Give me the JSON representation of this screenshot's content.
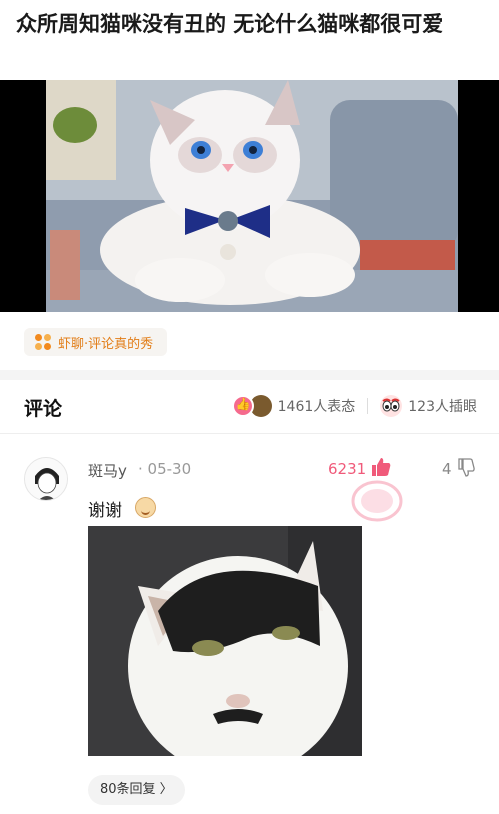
{
  "post": {
    "title": "众所周知猫咪没有丑的 无论什么猫咪都很可爱"
  },
  "topic_tag": {
    "label": "虾聊·评论真的秀",
    "color": "#e27d17"
  },
  "comments_header": {
    "title": "评论",
    "reactions_count": "1461人表态",
    "shares_count": "123人插眼"
  },
  "comment": {
    "username": "斑马y",
    "date": "· 05-30",
    "likes": "6231",
    "replies": "4",
    "text": "谢谢",
    "reply_button": "80条回复 〉"
  },
  "colors": {
    "accent_pink": "#f05a7a",
    "tag_orange": "#e27d17"
  },
  "icons": {
    "tag": "topic-grid-icon",
    "like": "thumb-up-icon",
    "dislike": "thumb-down-icon",
    "reaction_like": "like-emoji-icon",
    "reaction_hat": "hat-emoji-icon",
    "reaction_eyes": "eyes-emoji-icon",
    "emoji": "smile-emoji-icon",
    "stamp": "watermark-stamp-icon"
  }
}
